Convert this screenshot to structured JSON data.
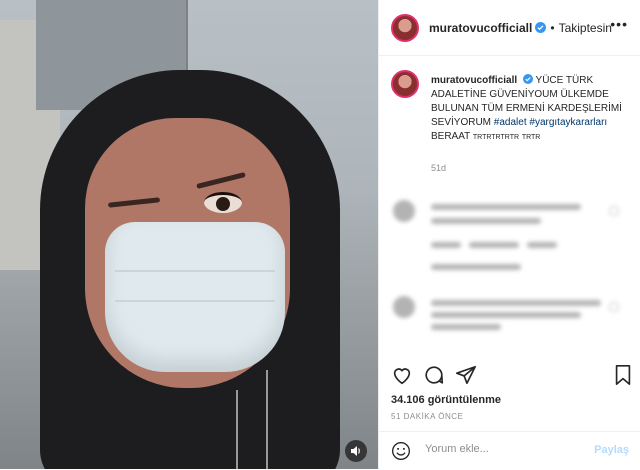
{
  "post": {
    "username": "muratovucofficiall",
    "follow_status": "Takiptesin",
    "caption_text": "YÜCE TÜRK ADALETİNE GÜVENİYOUM ÜLKEMDE BULUNAN TÜM ERMENİ KARDEŞLERİMİ SEVİYORUM",
    "hashtag_1": "#adalet",
    "hashtag_2": "#yargıtaykararları",
    "caption_tail": "BERAAT",
    "caption_trtr_1": "TRTRTRTRTR",
    "caption_trtr_2": "TRTR",
    "caption_age": "51d",
    "views": "34.106 görüntülenme",
    "time_ago": "51 DAKİKA ÖNCE"
  },
  "comment_box": {
    "placeholder": "Yorum ekle...",
    "post_label": "Paylaş"
  },
  "icons": {
    "verified": "verified-badge-icon",
    "like": "heart-icon",
    "comment": "comment-icon",
    "share": "paper-plane-icon",
    "save": "bookmark-icon",
    "audio": "speaker-icon",
    "emoji": "smile-icon",
    "more": "ellipsis-icon"
  },
  "colors": {
    "accent_blue": "#0095f6",
    "hashtag": "#00376b",
    "muted": "#8e8e8e",
    "post_disabled": "#b3dbff"
  }
}
